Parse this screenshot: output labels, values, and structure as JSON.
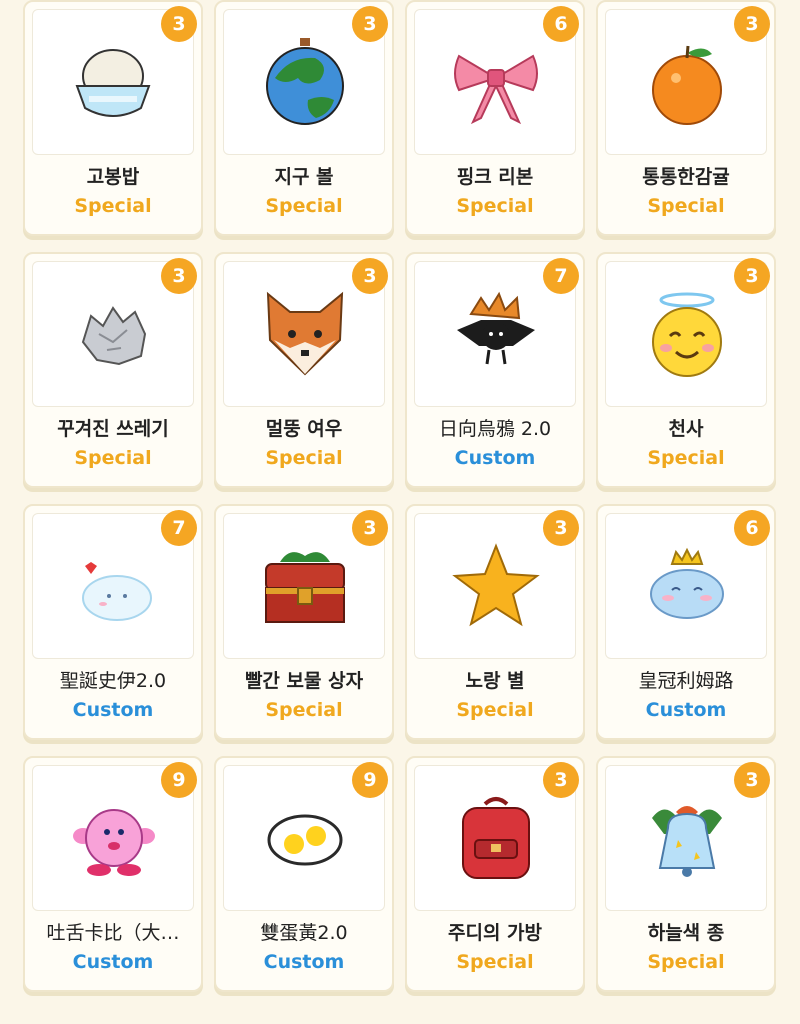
{
  "items": [
    {
      "name": "고봉밥",
      "type": "Special",
      "count": "3",
      "icon": "rice-bowl-icon",
      "bold": true
    },
    {
      "name": "지구 볼",
      "type": "Special",
      "count": "3",
      "icon": "earth-ball-icon",
      "bold": true
    },
    {
      "name": "핑크 리본",
      "type": "Special",
      "count": "6",
      "icon": "pink-ribbon-icon",
      "bold": true
    },
    {
      "name": "통통한감귤",
      "type": "Special",
      "count": "3",
      "icon": "tangerine-icon",
      "bold": true
    },
    {
      "name": "꾸겨진 쓰레기",
      "type": "Special",
      "count": "3",
      "icon": "crumpled-trash-icon",
      "bold": true
    },
    {
      "name": "멀뚱 여우",
      "type": "Special",
      "count": "3",
      "icon": "fox-icon",
      "bold": true
    },
    {
      "name": "日向烏鴉 2.0",
      "type": "Custom",
      "count": "7",
      "icon": "crow-icon",
      "bold": false
    },
    {
      "name": "천사",
      "type": "Special",
      "count": "3",
      "icon": "angel-icon",
      "bold": true
    },
    {
      "name": "聖誕史伊2.0",
      "type": "Custom",
      "count": "7",
      "icon": "cloud-slime-icon",
      "bold": false
    },
    {
      "name": "빨간 보물 상자",
      "type": "Special",
      "count": "3",
      "icon": "treasure-chest-icon",
      "bold": true
    },
    {
      "name": "노랑 별",
      "type": "Special",
      "count": "3",
      "icon": "yellow-star-icon",
      "bold": true
    },
    {
      "name": "皇冠利姆路",
      "type": "Custom",
      "count": "6",
      "icon": "crowned-slime-icon",
      "bold": false
    },
    {
      "name": "吐舌卡比（大…",
      "type": "Custom",
      "count": "9",
      "icon": "kirby-icon",
      "bold": false
    },
    {
      "name": "雙蛋黃2.0",
      "type": "Custom",
      "count": "9",
      "icon": "double-egg-icon",
      "bold": false
    },
    {
      "name": "주디의 가방",
      "type": "Special",
      "count": "3",
      "icon": "backpack-icon",
      "bold": true
    },
    {
      "name": "하늘색 종",
      "type": "Special",
      "count": "3",
      "icon": "sky-bell-icon",
      "bold": true
    }
  ]
}
